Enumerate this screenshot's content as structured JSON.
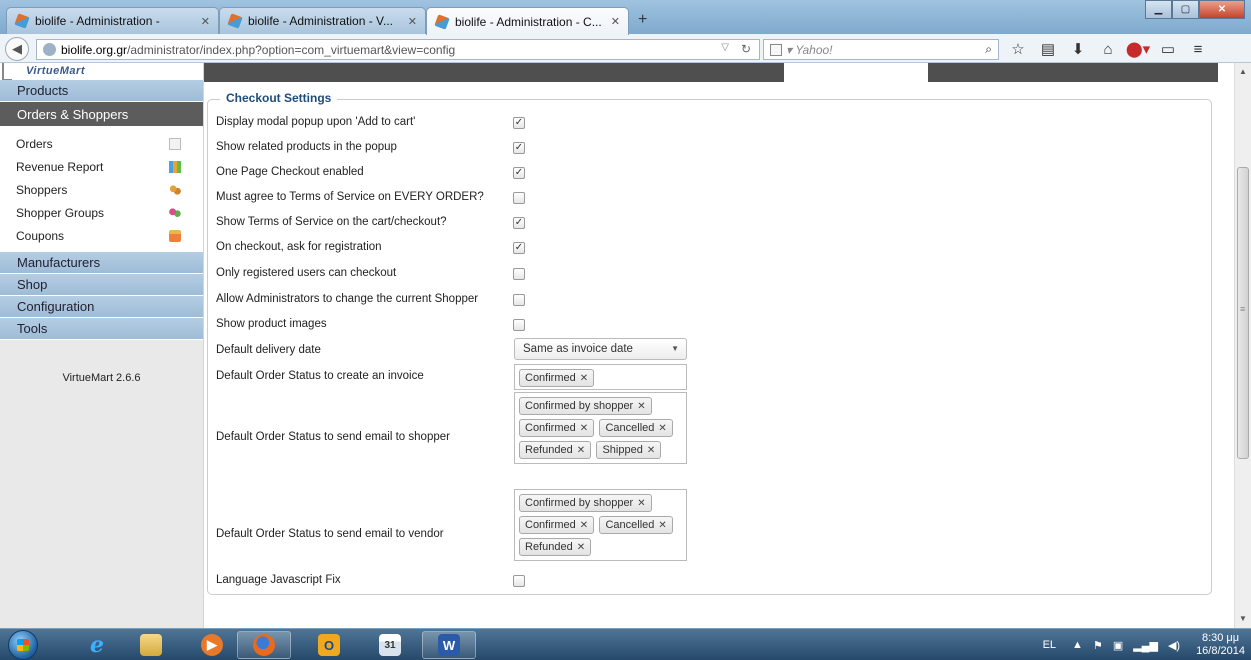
{
  "browser": {
    "tabs": [
      {
        "title": "biolife - Administration -",
        "active": false
      },
      {
        "title": "biolife - Administration - V...",
        "active": false
      },
      {
        "title": "biolife - Administration - C...",
        "active": true
      }
    ],
    "url_host": "biolife.org.gr",
    "url_path": "/administrator/index.php?option=com_virtuemart&view=config",
    "search_placeholder": "Yahoo!",
    "icons": [
      "search-icon",
      "star-icon",
      "reading-list-icon",
      "download-icon",
      "home-icon",
      "adblock-icon",
      "window-icon",
      "menu-icon"
    ]
  },
  "sidebar": {
    "logo": "VirtueMart",
    "menu": {
      "products": "Products",
      "orders_shoppers": "Orders & Shoppers",
      "manufacturers": "Manufacturers",
      "shop": "Shop",
      "configuration": "Configuration",
      "tools": "Tools"
    },
    "sub_items": [
      "Orders",
      "Revenue Report",
      "Shoppers",
      "Shopper Groups",
      "Coupons"
    ],
    "version": "VirtueMart 2.6.6"
  },
  "checkout": {
    "legend": "Checkout Settings",
    "options": [
      {
        "label": "Display modal popup upon 'Add to cart'",
        "checked": true
      },
      {
        "label": "Show related products in the popup",
        "checked": true
      },
      {
        "label": "One Page Checkout enabled",
        "checked": true
      },
      {
        "label": "Must agree to Terms of Service on EVERY ORDER?",
        "checked": false
      },
      {
        "label": "Show Terms of Service on the cart/checkout?",
        "checked": true
      },
      {
        "label": "On checkout, ask for registration",
        "checked": true
      },
      {
        "label": "Only registered users can checkout",
        "checked": false
      },
      {
        "label": "Allow Administrators to change the current Shopper",
        "checked": false
      },
      {
        "label": "Show product images",
        "checked": false
      }
    ],
    "delivery_date": {
      "label": "Default delivery date",
      "value": "Same as invoice date"
    },
    "invoice_status": {
      "label": "Default Order Status to create an invoice",
      "chips": [
        "Confirmed"
      ]
    },
    "shopper_email": {
      "label": "Default Order Status to send email to shopper",
      "chips": [
        "Confirmed by shopper",
        "Confirmed",
        "Cancelled",
        "Refunded",
        "Shipped"
      ]
    },
    "vendor_email": {
      "label": "Default Order Status to send email to vendor",
      "chips": [
        "Confirmed by shopper",
        "Confirmed",
        "Cancelled",
        "Refunded"
      ]
    },
    "language_fix": {
      "label": "Language Javascript Fix",
      "checked": false
    }
  },
  "taskbar": {
    "apps": [
      "internet-explorer",
      "file-explorer",
      "media-player",
      "firefox",
      "outlook",
      "calendar",
      "word"
    ],
    "language": "EL",
    "time": "8:30 μμ",
    "date": "16/8/2014"
  }
}
